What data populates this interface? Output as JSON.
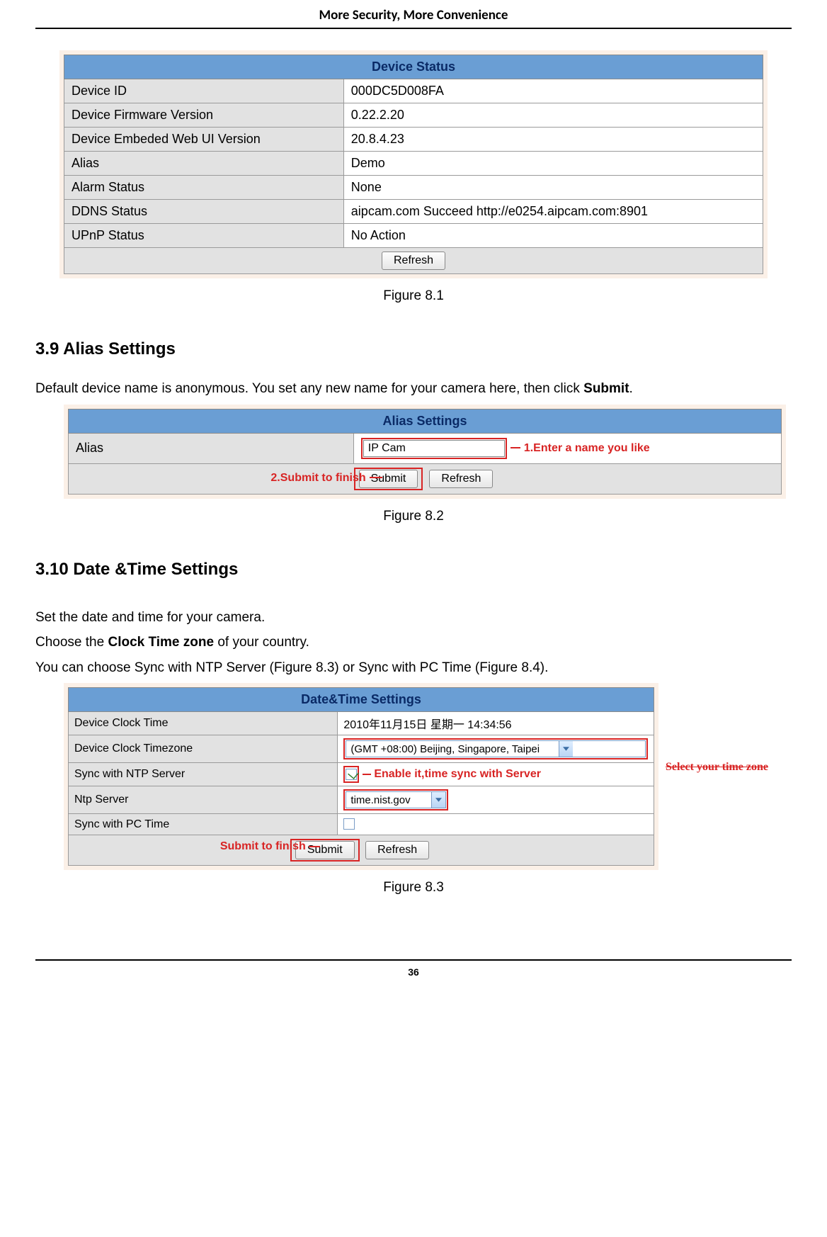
{
  "doc": {
    "header": "More Security, More Convenience",
    "page_number": "36"
  },
  "fig81": {
    "title": "Device Status",
    "rows": [
      {
        "label": "Device ID",
        "value": "000DC5D008FA"
      },
      {
        "label": "Device Firmware Version",
        "value": "0.22.2.20"
      },
      {
        "label": "Device Embeded Web UI Version",
        "value": "20.8.4.23"
      },
      {
        "label": "Alias",
        "value": "Demo"
      },
      {
        "label": "Alarm Status",
        "value": "None"
      },
      {
        "label": "DDNS Status",
        "value": "aipcam.com  Succeed  http://e0254.aipcam.com:8901"
      },
      {
        "label": "UPnP Status",
        "value": "No Action"
      }
    ],
    "refresh": "Refresh",
    "caption": "Figure 8.1"
  },
  "sec39": {
    "heading": "3.9 Alias Settings",
    "p1_a": "Default device name is anonymous. You set any new name for your camera here, then click ",
    "p1_b": "Submit",
    "p1_c": "."
  },
  "fig82": {
    "title": "Alias Settings",
    "alias_label": "Alias",
    "alias_value": "IP Cam",
    "submit": "Submit",
    "refresh": "Refresh",
    "ann_enter": "1.Enter a name you like",
    "ann_submit": "2.Submit to finish",
    "caption": "Figure 8.2"
  },
  "sec310": {
    "heading": "3.10 Date &Time Settings",
    "p1": "Set the date and time for your camera.",
    "p2_a": "Choose the ",
    "p2_b": "Clock Time zone",
    "p2_c": " of your country.",
    "p3": "You can choose Sync with NTP Server (Figure 8.3) or Sync with PC Time (Figure 8.4)."
  },
  "fig83": {
    "title": "Date&Time Settings",
    "clock_time_label": "Device Clock Time",
    "clock_time_value": "2010年11月15日  星期一  14:34:56",
    "tz_label": "Device Clock Timezone",
    "tz_value": "(GMT +08:00) Beijing, Singapore, Taipei",
    "sync_ntp_label": "Sync with NTP Server",
    "ntp_server_label": "Ntp Server",
    "ntp_server_value": "time.nist.gov",
    "sync_pc_label": "Sync with PC Time",
    "submit": "Submit",
    "refresh": "Refresh",
    "ann_enable": "Enable it,time sync with Server",
    "ann_tz": "Select your time zone",
    "ann_submit": "Submit to finish",
    "caption": "Figure 8.3"
  }
}
